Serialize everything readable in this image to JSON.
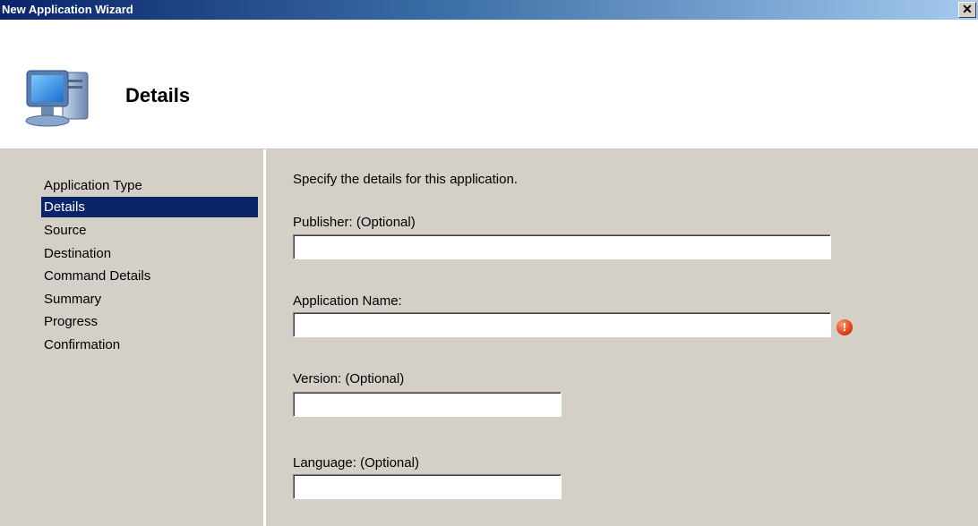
{
  "window": {
    "title": "New Application Wizard",
    "close_glyph": "✕"
  },
  "header": {
    "title": "Details",
    "icon": "computer-icon"
  },
  "sidebar": {
    "items": [
      {
        "label": "Application Type",
        "active": false
      },
      {
        "label": "Details",
        "active": true
      },
      {
        "label": "Source",
        "active": false
      },
      {
        "label": "Destination",
        "active": false
      },
      {
        "label": "Command Details",
        "active": false
      },
      {
        "label": "Summary",
        "active": false
      },
      {
        "label": "Progress",
        "active": false
      },
      {
        "label": "Confirmation",
        "active": false
      }
    ]
  },
  "main": {
    "intro": "Specify the details for this application.",
    "fields": {
      "publisher": {
        "label": "Publisher: (Optional)",
        "value": ""
      },
      "app_name": {
        "label": "Application Name:",
        "value": "",
        "error_glyph": "!"
      },
      "version": {
        "label": "Version: (Optional)",
        "value": ""
      },
      "language": {
        "label": "Language: (Optional)",
        "value": ""
      }
    }
  },
  "colors": {
    "selection": "#0a246a",
    "dialog_bg": "#d4d0c8",
    "error": "#e0401a"
  }
}
